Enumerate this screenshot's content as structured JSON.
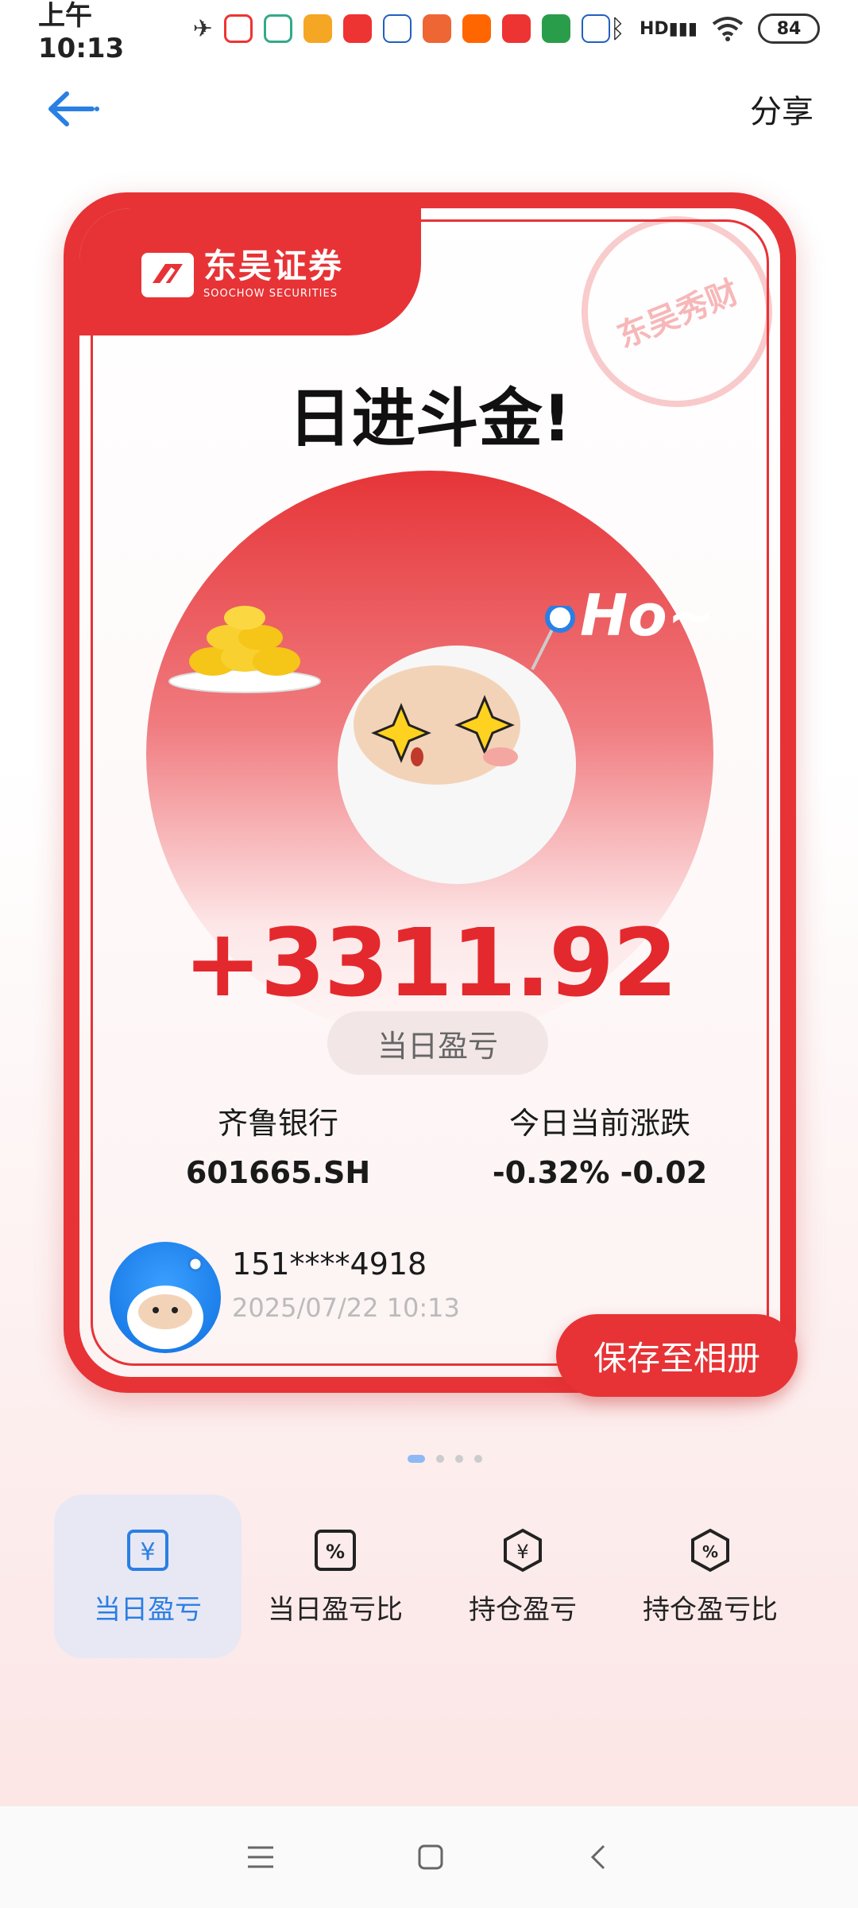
{
  "status_bar": {
    "time": "上午10:13",
    "battery": "84",
    "signal_label": "HD"
  },
  "top_nav": {
    "share_label": "分享"
  },
  "card": {
    "brand_name": "东吴证券",
    "brand_sub": "SOOCHOW SECURITIES",
    "stamp_text": "东吴秀财",
    "slogan": "日进斗金!",
    "mascot_callout": "Ho~",
    "amount": "+3311.92",
    "amount_label": "当日盈亏",
    "stock_name": "齐鲁银行",
    "stock_code": "601665.SH",
    "change_title": "今日当前涨跌",
    "change_value": "-0.32% -0.02",
    "phone": "151****4918",
    "datetime": "2025/07/22 10:13"
  },
  "save_button": "保存至相册",
  "pager": {
    "count": 4,
    "active": 0
  },
  "tabs": [
    {
      "label": "当日盈亏",
      "icon": "yen-square-icon",
      "active": true
    },
    {
      "label": "当日盈亏比",
      "icon": "percent-square-icon",
      "active": false
    },
    {
      "label": "持仓盈亏",
      "icon": "yen-hexagon-icon",
      "active": false
    },
    {
      "label": "持仓盈亏比",
      "icon": "percent-hexagon-icon",
      "active": false
    }
  ],
  "colors": {
    "brand_red": "#e73336",
    "accent_blue": "#2a7fe3"
  }
}
